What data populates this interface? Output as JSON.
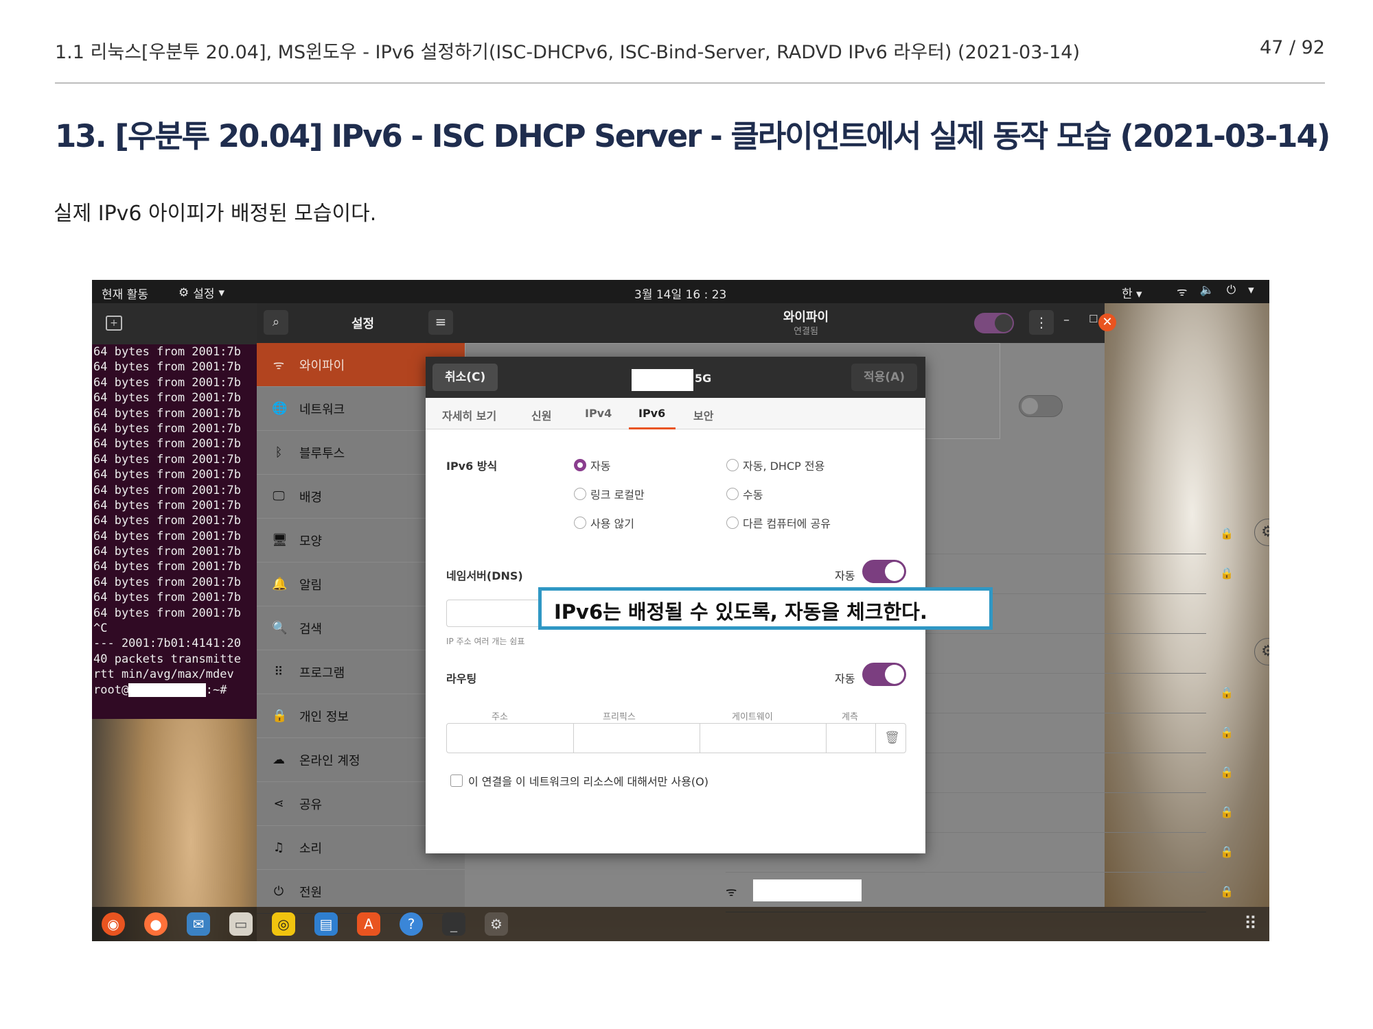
{
  "header": {
    "title": "1.1 리눅스[우분투 20.04], MS윈도우 - IPv6 설정하기(ISC-DHCPv6, ISC-Bind-Server, RADVD IPv6 라우터) (2021-03-14)",
    "page": "47 / 92"
  },
  "section_title": "13. [우분투 20.04] IPv6 - ISC DHCP Server - 클라이언트에서 실제 동작 모습 (2021-03-14)",
  "body_text": "실제 IPv6 아이피가 배정된 모습이다.",
  "screenshot": {
    "topbar": {
      "activities": "현재 활동",
      "settings_menu": "설정",
      "clock": "3월 14일 16 : 23",
      "input_method": "한"
    },
    "terminal": {
      "ping_line": "64 bytes from 2001:7b",
      "ping_count": 18,
      "tail": [
        "^C",
        "--- 2001:7b01:4141:20",
        "40 packets transmitte",
        "rtt min/avg/max/mdev",
        "root@"
      ],
      "prompt_suffix": ":~# "
    },
    "settings": {
      "app_title": "설정",
      "panel_title": "와이파이",
      "panel_subtitle": "연결됨",
      "sidebar": [
        {
          "label": "와이파이",
          "icon": "wifi-icon",
          "glyph": "ᯤ",
          "active": true
        },
        {
          "label": "네트워크",
          "icon": "network-icon",
          "glyph": "🌐"
        },
        {
          "label": "블루투스",
          "icon": "bluetooth-icon",
          "glyph": "ᛒ"
        },
        {
          "label": "배경",
          "icon": "background-icon",
          "glyph": "🖵"
        },
        {
          "label": "모양",
          "icon": "appearance-icon",
          "glyph": "🖥"
        },
        {
          "label": "알림",
          "icon": "bell-icon",
          "glyph": "🔔"
        },
        {
          "label": "검색",
          "icon": "search-icon",
          "glyph": "🔍"
        },
        {
          "label": "프로그램",
          "icon": "apps-icon",
          "glyph": "⠿"
        },
        {
          "label": "개인 정보",
          "icon": "lock-icon",
          "glyph": "🔒"
        },
        {
          "label": "온라인 계정",
          "icon": "cloud-icon",
          "glyph": "☁"
        },
        {
          "label": "공유",
          "icon": "share-icon",
          "glyph": "⋖"
        },
        {
          "label": "소리",
          "icon": "music-icon",
          "glyph": "♫"
        },
        {
          "label": "전원",
          "icon": "power-icon",
          "glyph": "⏻"
        }
      ]
    },
    "dialog": {
      "cancel": "취소(C)",
      "ssid_suffix": "5G",
      "apply": "적용(A)",
      "tabs": [
        "자세히 보기",
        "신원",
        "IPv4",
        "IPv6",
        "보안"
      ],
      "active_tab": "IPv6",
      "ipv6_method_label": "IPv6 방식",
      "methods": [
        {
          "label": "자동",
          "selected": true
        },
        {
          "label": "자동, DHCP 전용",
          "selected": false
        },
        {
          "label": "링크 로컬만",
          "selected": false
        },
        {
          "label": "수동",
          "selected": false
        },
        {
          "label": "사용 않기",
          "selected": false
        },
        {
          "label": "다른 컴퓨터에 공유",
          "selected": false
        }
      ],
      "dns_label": "네임서버(DNS)",
      "auto_label": "자동",
      "dns_hint": "IP 주소 여러 개는 쉼표",
      "routing_label": "라우팅",
      "route_columns": [
        "주소",
        "프리픽스",
        "게이트웨이",
        "계측"
      ],
      "only_local_checkbox": "이 연결을 이 네트워크의 리소스에 대해서만 사용(O)"
    },
    "callout": "IPv6는 배정될 수 있도록, 자동을 체크한다."
  }
}
